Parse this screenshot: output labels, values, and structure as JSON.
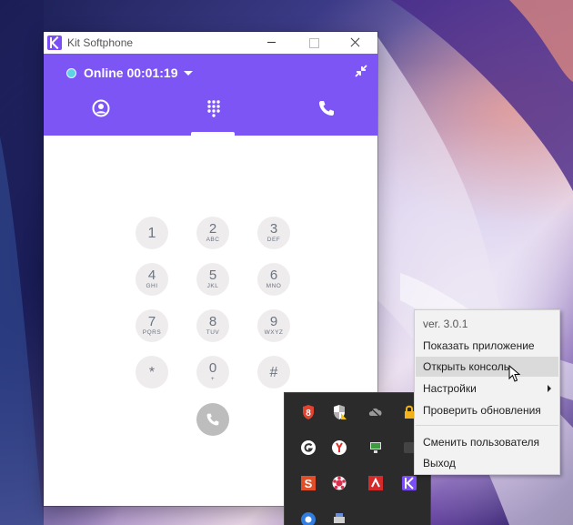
{
  "window": {
    "title": "Kit Softphone",
    "accent_color": "#7d55f5"
  },
  "status": {
    "label": "Online 00:01:19",
    "dot_color": "#5fd3e6"
  },
  "tabs": [
    {
      "name": "contacts",
      "icon": "person-icon"
    },
    {
      "name": "dialpad",
      "icon": "dialpad-icon",
      "active": true
    },
    {
      "name": "calls",
      "icon": "phone-icon"
    }
  ],
  "dialpad": {
    "keys": [
      {
        "digit": "1",
        "letters": ""
      },
      {
        "digit": "2",
        "letters": "ABC"
      },
      {
        "digit": "3",
        "letters": "DEF"
      },
      {
        "digit": "4",
        "letters": "GHI"
      },
      {
        "digit": "5",
        "letters": "JKL"
      },
      {
        "digit": "6",
        "letters": "MNO"
      },
      {
        "digit": "7",
        "letters": "PQRS"
      },
      {
        "digit": "8",
        "letters": "TUV"
      },
      {
        "digit": "9",
        "letters": "WXYZ"
      },
      {
        "digit": "*",
        "letters": ""
      },
      {
        "digit": "0",
        "letters": "+"
      },
      {
        "digit": "#",
        "letters": ""
      }
    ],
    "call_icon": "phone-icon"
  },
  "context_menu": {
    "version": "ver. 3.0.1",
    "show_app": "Показать приложение",
    "open_console": "Открыть консоль",
    "settings": "Настройки",
    "check_updates": "Проверить обновления",
    "switch_user": "Сменить пользователя",
    "exit": "Выход"
  },
  "tray_icons": [
    "shield-8-icon",
    "security-shield-icon",
    "cloud-offline-icon",
    "lock-icon",
    "g-circle-icon",
    "yandex-browser-icon",
    "monitor-network-icon",
    "generic-app-icon",
    "s-app-icon",
    "gear-flower-icon",
    "red-app-icon",
    "kit-softphone-icon",
    "blue-circle-icon",
    "printer-icon"
  ]
}
